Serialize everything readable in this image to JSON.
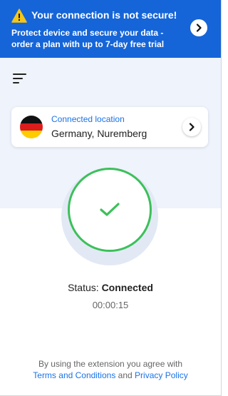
{
  "banner": {
    "title": "Your connection is not secure!",
    "text": "Protect device and secure your data - order a plan with up to 7-day free trial",
    "icon": "warning-icon",
    "arrow_icon": "chevron-right-icon",
    "background": "#1565d8"
  },
  "menu": {
    "icon": "hamburger-menu-icon"
  },
  "location": {
    "label": "Connected location",
    "value": "Germany, Nuremberg",
    "flag": "germany-flag-icon",
    "arrow_icon": "chevron-right-icon"
  },
  "connection": {
    "icon": "checkmark-icon",
    "ring_color": "#3cc05a",
    "status_label": "Status:",
    "status_value": "Connected",
    "timer": "00:00:15"
  },
  "footer": {
    "text_before": "By using the extension you agree with",
    "terms_link": "Terms and Conditions",
    "and": "and",
    "privacy_link": "Privacy Policy"
  }
}
